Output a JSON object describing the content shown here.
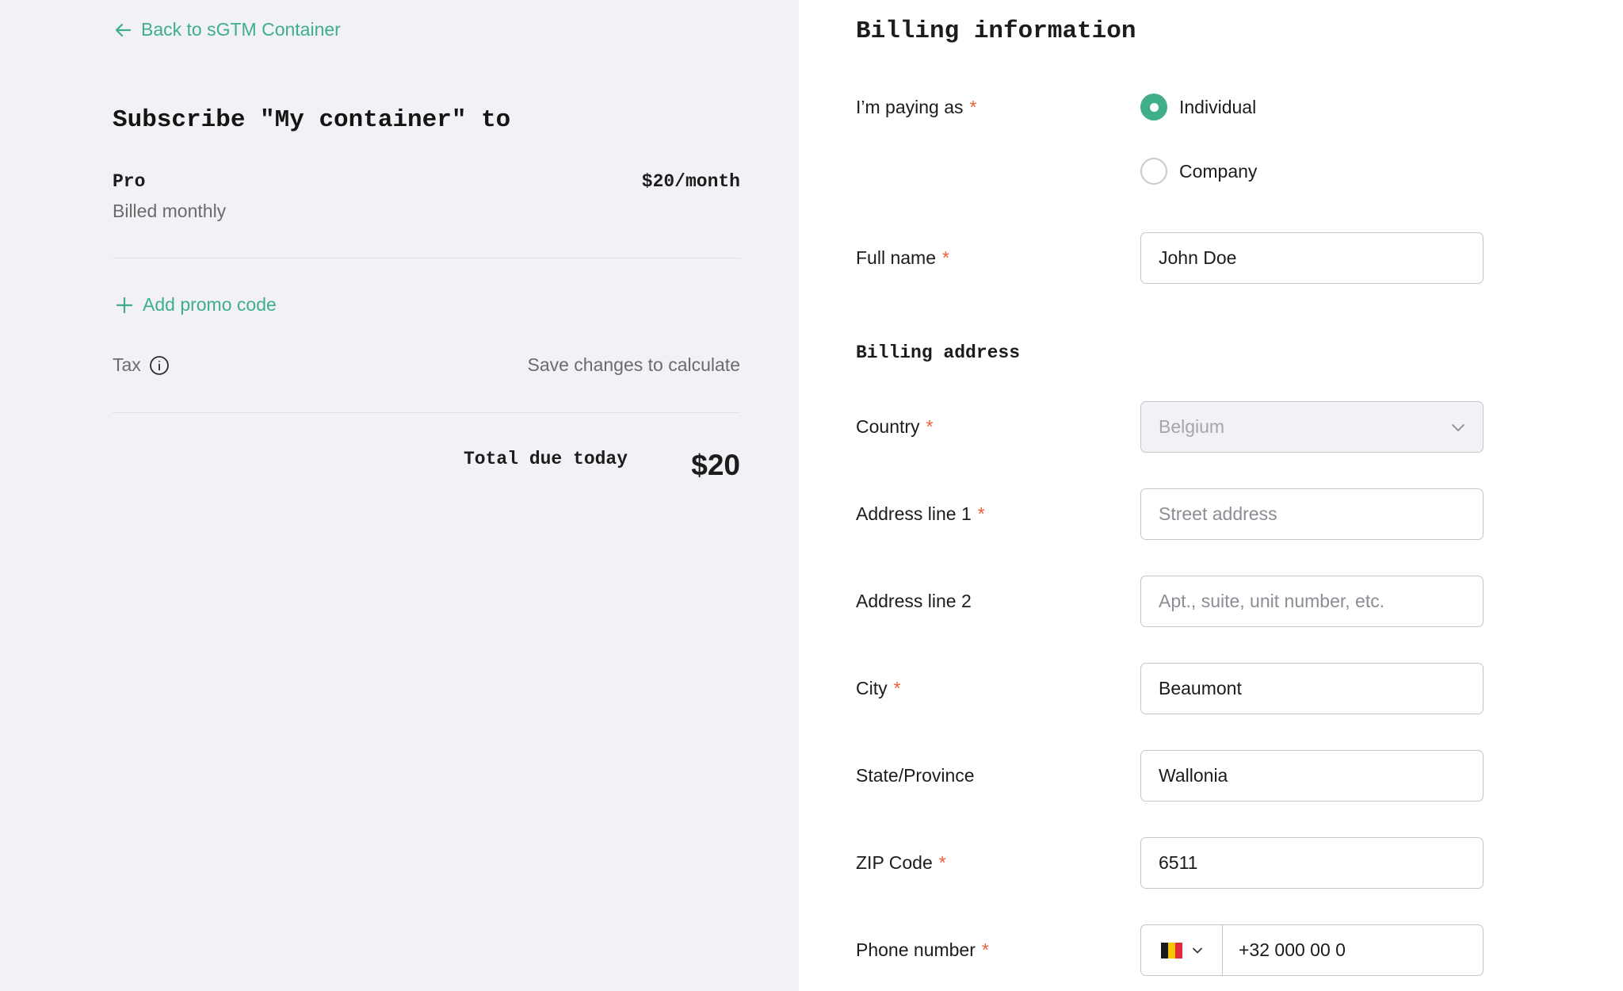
{
  "summary": {
    "back_link": "Back to sGTM Container",
    "title": "Subscribe \"My container\" to",
    "plan_name": "Pro",
    "plan_price": "$20/month",
    "plan_billing": "Billed monthly",
    "promo_link": "Add promo code",
    "tax_label": "Tax",
    "tax_value": "Save changes to calculate",
    "total_label": "Total due today",
    "total_value": "$20",
    "accent_color": "#3fae8a"
  },
  "billing": {
    "title": "Billing information",
    "paying_as": {
      "label": "I’m paying as",
      "options": [
        {
          "label": "Individual",
          "selected": true
        },
        {
          "label": "Company",
          "selected": false
        }
      ]
    },
    "full_name": {
      "label": "Full name",
      "value": "John Doe"
    },
    "address_section": "Billing address",
    "country": {
      "label": "Country",
      "value": "Belgium"
    },
    "address1": {
      "label": "Address line 1",
      "placeholder": "Street address"
    },
    "address2": {
      "label": "Address line 2",
      "placeholder": "Apt., suite, unit number, etc."
    },
    "city": {
      "label": "City",
      "value": "Beaumont"
    },
    "state": {
      "label": "State/Province",
      "value": "Wallonia"
    },
    "zip": {
      "label": "ZIP Code",
      "value": "6511"
    },
    "phone": {
      "label": "Phone number",
      "value": "+32 000 00 0",
      "flag": "belgium-flag-icon"
    },
    "required_mark": "*",
    "required_color": "#ef5c3a"
  }
}
